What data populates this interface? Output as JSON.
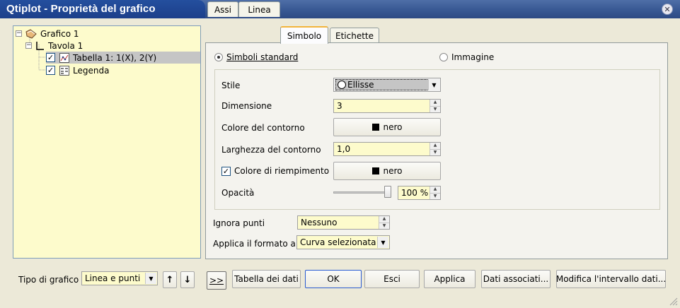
{
  "window": {
    "title": "Qtiplot - Proprietà del grafico",
    "close_glyph": "✕"
  },
  "tree": {
    "graph": {
      "expander": "−",
      "label": "Grafico 1"
    },
    "layer": {
      "expander": "−",
      "label": "Tavola 1"
    },
    "curve": {
      "checked": "✓",
      "label": "Tabella 1: 1(X), 2(Y)"
    },
    "legend": {
      "checked": "✓",
      "label": "Legenda"
    }
  },
  "tabs": [
    {
      "label": "Assi"
    },
    {
      "label": "Linea"
    },
    {
      "label": "Simbolo",
      "active": true
    },
    {
      "label": "Etichette"
    }
  ],
  "symbol": {
    "standard_label": "Simboli standard",
    "image_label": "Immagine",
    "standard_selected": true,
    "style_label": "Stile",
    "style_value": "Ellisse",
    "size_label": "Dimensione",
    "size_value": "3",
    "edge_color_label": "Colore del contorno",
    "edge_color_value": "nero",
    "edge_width_label": "Larghezza del contorno",
    "edge_width_value": "1,0",
    "fill_label": "Colore di riempimento",
    "fill_checked": "✓",
    "fill_color_value": "nero",
    "opacity_label": "Opacità",
    "opacity_value": "100 %",
    "opacity_level": 1.0
  },
  "skip": {
    "label": "Ignora punti",
    "value": "Nessuno"
  },
  "apply_format": {
    "label": "Applica il formato a",
    "value": "Curva selezionata"
  },
  "footer": {
    "plot_type_label": "Tipo di grafico",
    "plot_type_value": "Linea e punti",
    "up_arrow": "🡑",
    "down_arrow": "🡓",
    "expand_label": ">>",
    "data_table": "Tabella dei dati",
    "ok": "OK",
    "cancel": "Esci",
    "apply": "Applica",
    "associated_data": "Dati associati...",
    "edit_range": "Modifica l'intervallo dati..."
  },
  "colors": {
    "title_bar": "#2d4a84",
    "tree_bg": "#fdfbcc",
    "field_bg": "#fdfbcc",
    "active_tab_border": "#f2b43c"
  }
}
